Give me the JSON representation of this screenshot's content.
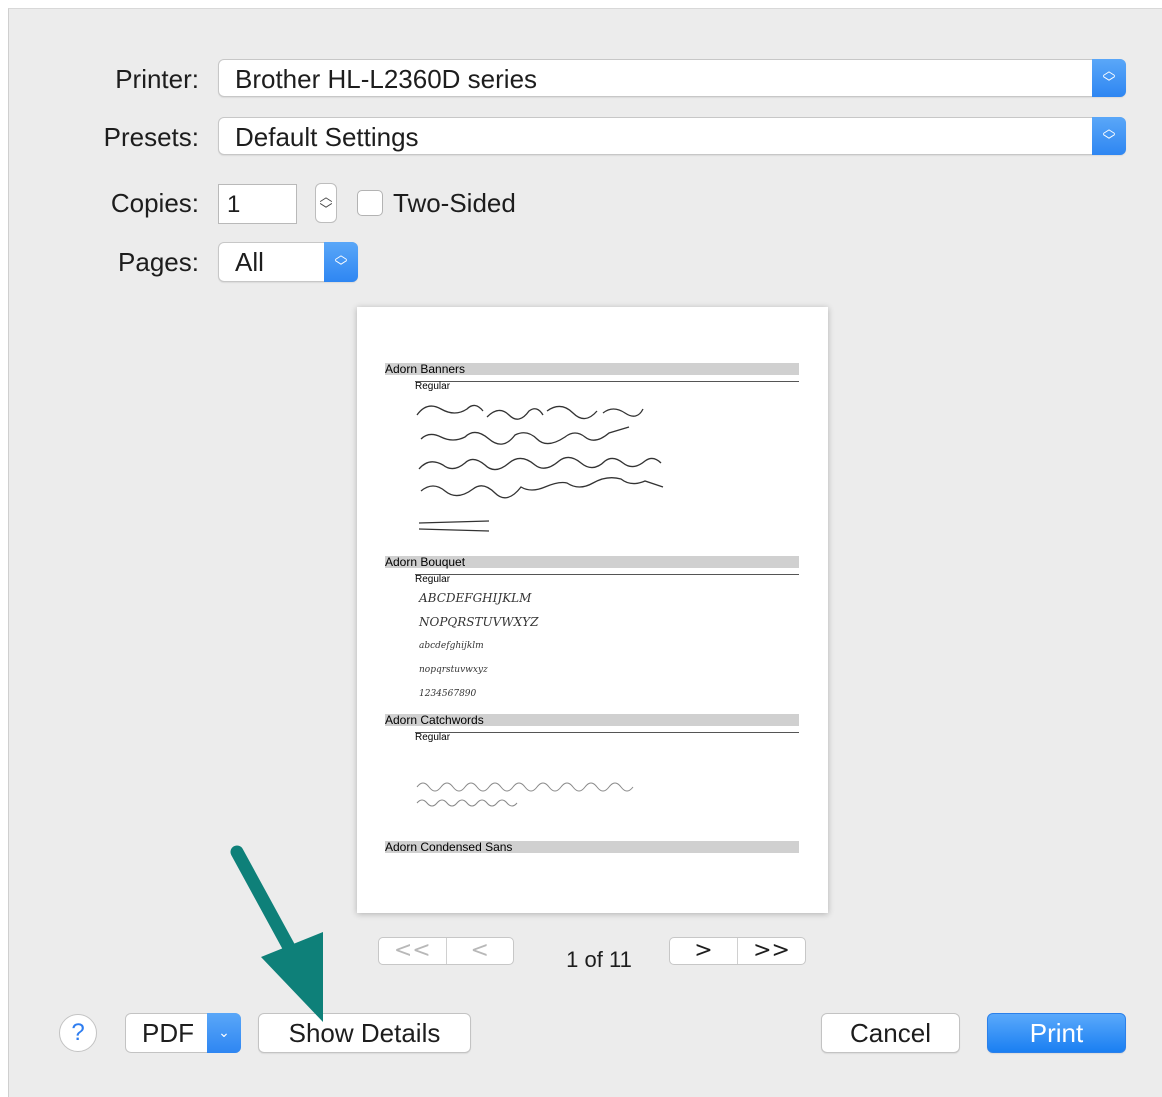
{
  "printer": {
    "label": "Printer:",
    "value": "Brother HL-L2360D series"
  },
  "presets": {
    "label": "Presets:",
    "value": "Default Settings"
  },
  "copies": {
    "label": "Copies:",
    "value": "1",
    "two_sided_label": "Two-Sided",
    "two_sided_checked": false
  },
  "pages": {
    "label": "Pages:",
    "value": "All"
  },
  "preview": {
    "sections": [
      {
        "title": "Adorn Banners",
        "style": "Regular"
      },
      {
        "title": "Adorn Bouquet",
        "style": "Regular",
        "samples": [
          "ABCDEFGHIJKLM",
          "NOPQRSTUVWXYZ",
          "abcdefghijklm",
          "nopqrstuvwxyz",
          "1234567890"
        ]
      },
      {
        "title": "Adorn Catchwords",
        "style": "Regular"
      },
      {
        "title": "Adorn Condensed Sans"
      }
    ]
  },
  "pagination": {
    "first": "<<",
    "prev": "<",
    "text": "1 of 11",
    "next": ">",
    "last": ">>"
  },
  "footer": {
    "help": "?",
    "pdf": "PDF",
    "show_details": "Show Details",
    "cancel": "Cancel",
    "print": "Print"
  },
  "colors": {
    "accent": "#2e86f2",
    "arrow": "#0e8079"
  }
}
